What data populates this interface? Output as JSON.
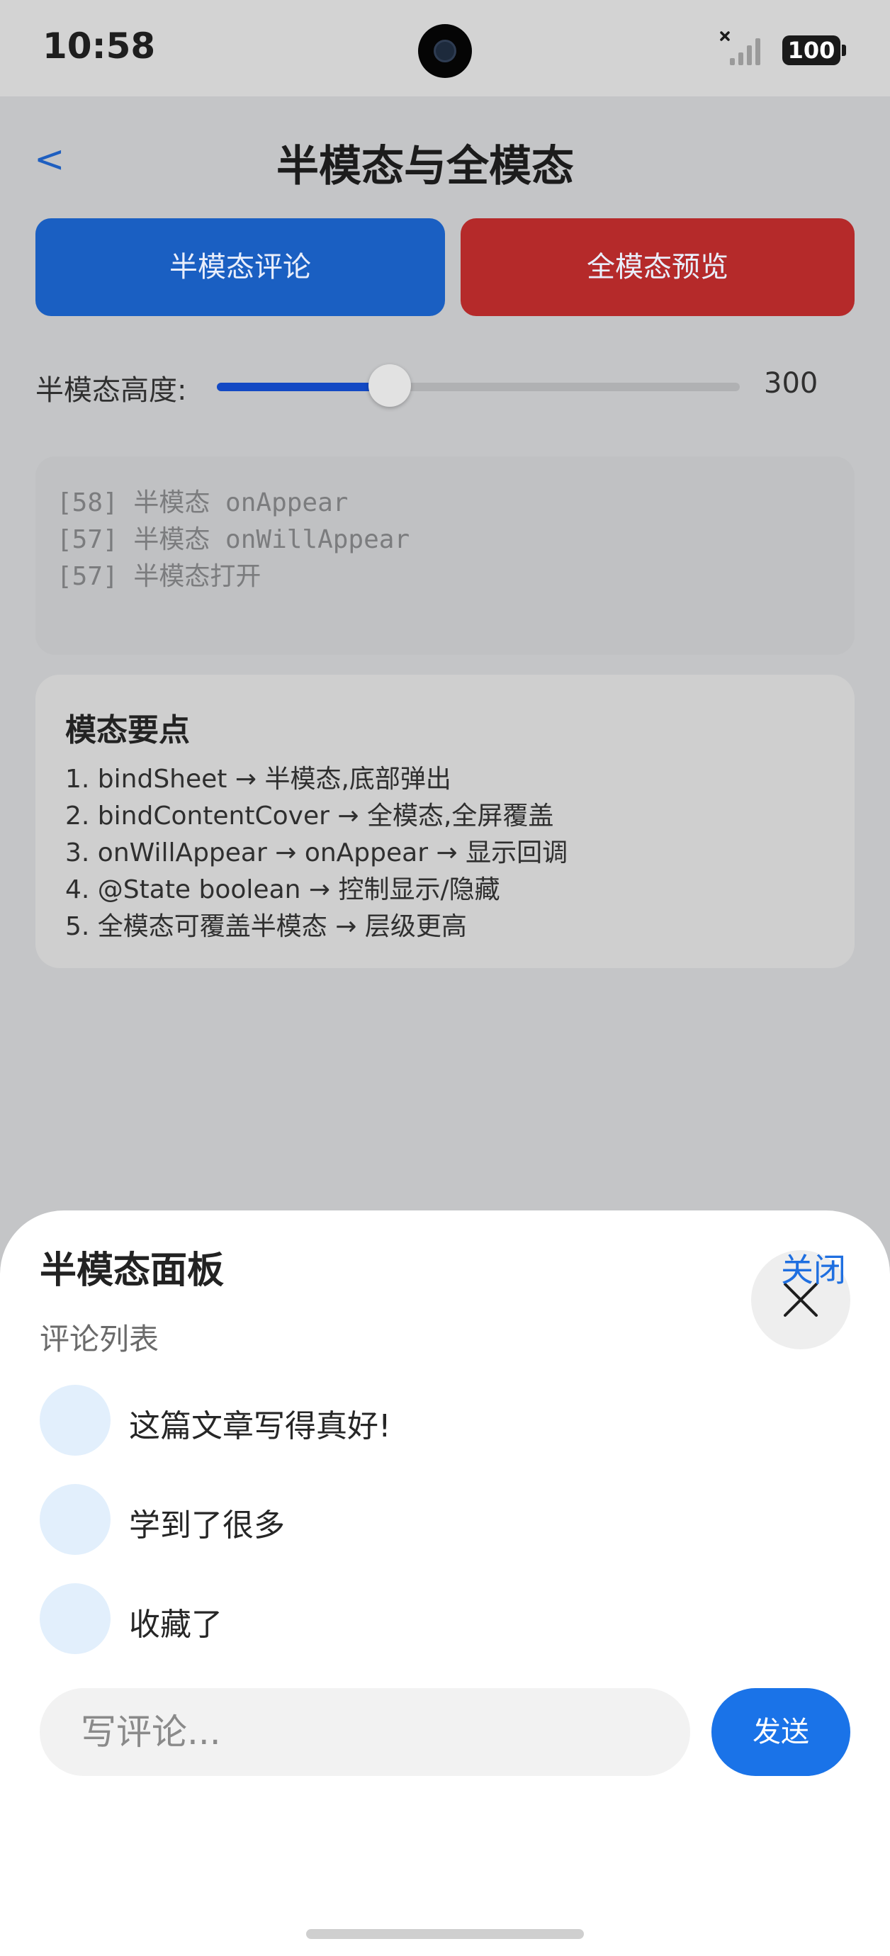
{
  "status_bar": {
    "time": "10:58",
    "battery": "100",
    "signal_icon": "signal-off-icon"
  },
  "header": {
    "back_label": "<",
    "title": "半模态与全模态"
  },
  "buttons": {
    "half_modal": "半模态评论",
    "full_modal": "全模态预览"
  },
  "slider": {
    "label": "半模态高度:",
    "value": "300",
    "fraction": 0.33
  },
  "logs": [
    "[58] 半模态 onAppear",
    "[57] 半模态 onWillAppear",
    "[57] 半模态打开"
  ],
  "tips": {
    "title": "模态要点",
    "items": [
      "1. bindSheet → 半模态,底部弹出",
      "2. bindContentCover → 全模态,全屏覆盖",
      "3. onWillAppear → onAppear → 显示回调",
      "4. @State boolean → 控制显示/隐藏",
      "5. 全模态可覆盖半模态 → 层级更高"
    ]
  },
  "sheet": {
    "title": "半模态面板",
    "close_label": "关闭",
    "subtitle": "评论列表",
    "comments": [
      "这篇文章写得真好!",
      "学到了很多",
      "收藏了"
    ],
    "input_placeholder": "写评论...",
    "send_label": "发送"
  },
  "colors": {
    "primary_blue": "#1a5fc2",
    "danger_red": "#b52a2a",
    "slider_fill": "#1349c4",
    "send_blue": "#1a73e8",
    "avatar_bg": "#e2effc"
  }
}
